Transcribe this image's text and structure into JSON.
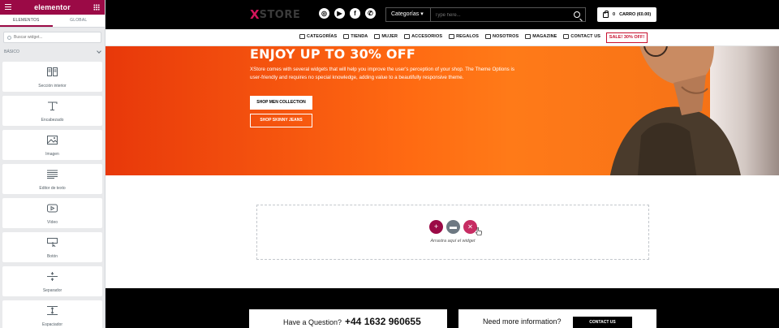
{
  "panel": {
    "logo": "elementor",
    "tabs": [
      "ELEMENTOS",
      "GLOBAL"
    ],
    "search_placeholder": "Buscar widget...",
    "category": "BÁSICO",
    "widgets": [
      {
        "label": "Sección interior",
        "icon": "columns-icon"
      },
      {
        "label": "Encabezado",
        "icon": "heading-icon"
      },
      {
        "label": "Imagen",
        "icon": "image-icon"
      },
      {
        "label": "Editor de texto",
        "icon": "text-editor-icon"
      },
      {
        "label": "Vídeo",
        "icon": "video-icon"
      },
      {
        "label": "Botón",
        "icon": "button-icon"
      },
      {
        "label": "Separador",
        "icon": "divider-icon"
      },
      {
        "label": "Espaciador",
        "icon": "spacer-icon"
      }
    ]
  },
  "header": {
    "brand_x": "X",
    "brand_rest": "STORE",
    "socials": [
      "instagram",
      "youtube",
      "facebook",
      "whatsapp"
    ],
    "category_select": "Categorías",
    "search_placeholder": "Type here...",
    "cart_count": "0",
    "cart_label": "CARRO (€0.00)"
  },
  "nav": {
    "items": [
      "CATEGORÍAS",
      "TIENDA",
      "MUJER",
      "ACCESORIOS",
      "REGALOS",
      "NOSOTROS",
      "MAGAZINE",
      "CONTACT US"
    ],
    "sale": "SALE! 30% OFF!"
  },
  "hero": {
    "title": "ENJOY UP TO 30% OFF",
    "description": "XStore comes with several widgets that will help you improve the user's perception of your shop. The Theme Options is user-friendly and requires no special knowledge, adding value to a beautifully responsive theme.",
    "primary_button": "SHOP MEN COLLECTION",
    "secondary_button": "SHOP SKINNY JEANS"
  },
  "dropzone": {
    "label": "Arrastra aquí el widget"
  },
  "footer": {
    "question": "Have a Question?",
    "phone": "+44 1632 960655",
    "more_info": "Need more information?",
    "contact_button": "CONTACT US"
  },
  "colors": {
    "elementor_brand": "#9b0a46",
    "hero_orange": "#ff6a12",
    "sale_red": "#c8102e"
  }
}
